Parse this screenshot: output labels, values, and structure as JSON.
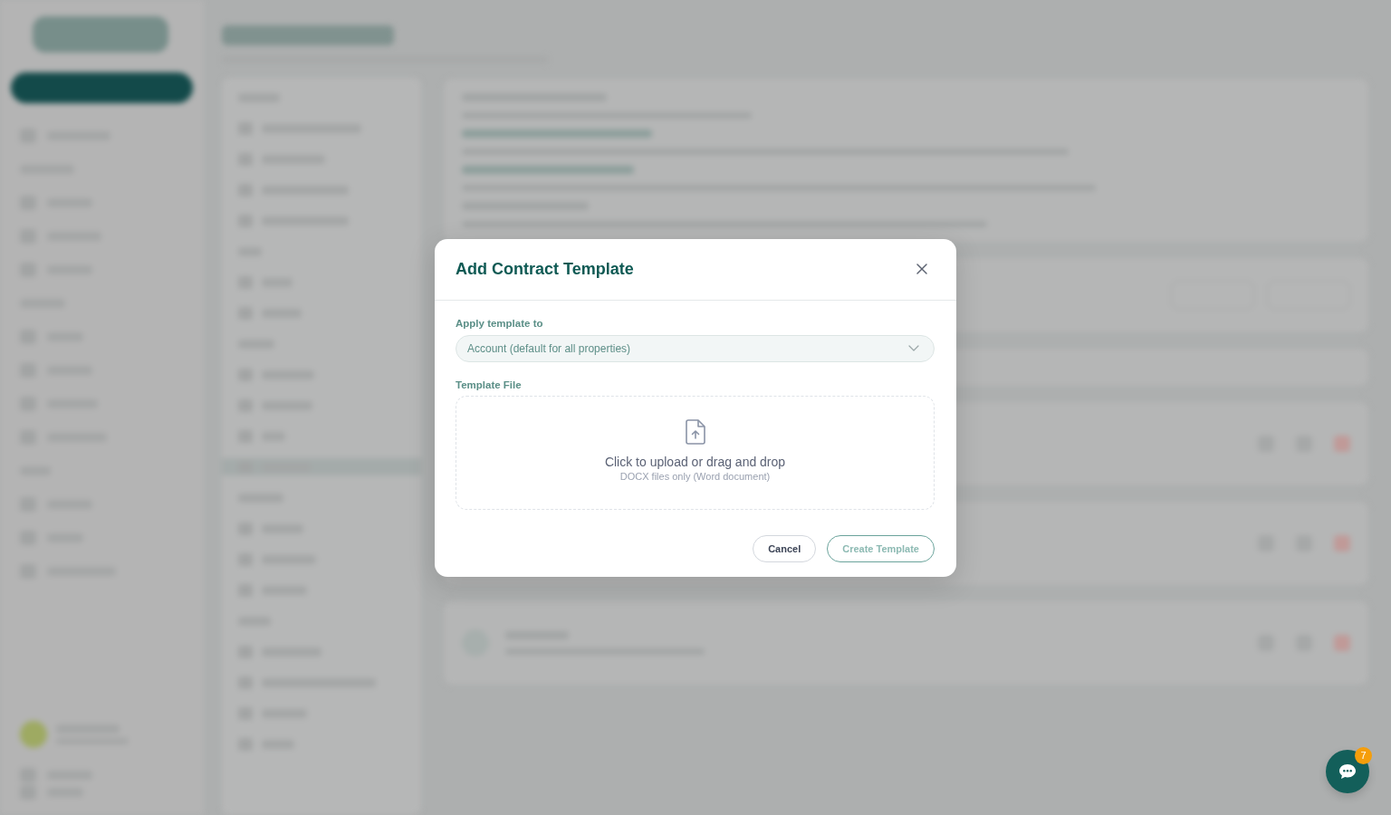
{
  "dialog": {
    "title": "Add Contract Template",
    "apply_to": {
      "label": "Apply template to",
      "value": "Account (default for all properties)"
    },
    "template_file": {
      "label": "Template File",
      "prompt": "Click to upload or drag and drop",
      "hint": "DOCX files only (Word document)"
    },
    "buttons": [
      {
        "label": "Cancel",
        "kind": "secondary",
        "disabled": false
      },
      {
        "label": "Create Template",
        "kind": "primary",
        "disabled": true
      }
    ]
  },
  "chat_button": {
    "badge": "7"
  }
}
